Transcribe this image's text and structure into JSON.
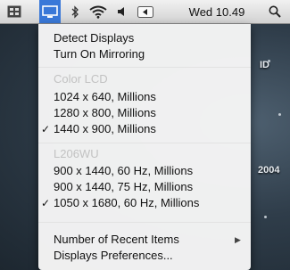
{
  "menubar": {
    "clock": "Wed 10.49",
    "icons": [
      "screen-mirroring-icon",
      "displays-icon",
      "bluetooth-icon",
      "wifi-icon",
      "volume-icon",
      "input-menu-icon",
      "spotlight-icon"
    ]
  },
  "menu": {
    "detect_displays": "Detect Displays",
    "turn_on_mirroring": "Turn On Mirroring",
    "group1_header": "Color LCD",
    "group1": [
      {
        "label": "1024 x 640, Millions",
        "checked": false
      },
      {
        "label": "1280 x 800, Millions",
        "checked": false
      },
      {
        "label": "1440 x 900, Millions",
        "checked": true
      }
    ],
    "group2_header": "L206WU",
    "group2": [
      {
        "label": "900 x 1440, 60 Hz, Millions",
        "checked": false
      },
      {
        "label": "900 x 1440, 75 Hz, Millions",
        "checked": false
      },
      {
        "label": "1050 x 1680, 60 Hz, Millions",
        "checked": true
      }
    ],
    "recent_items": "Number of Recent Items",
    "preferences": "Displays Preferences...",
    "check_glyph": "✓"
  },
  "desktop": {
    "label_id": "ID",
    "label_year": "2004"
  },
  "colors": {
    "highlight": "#3a78d8",
    "header_text": "#c2c2c2"
  }
}
